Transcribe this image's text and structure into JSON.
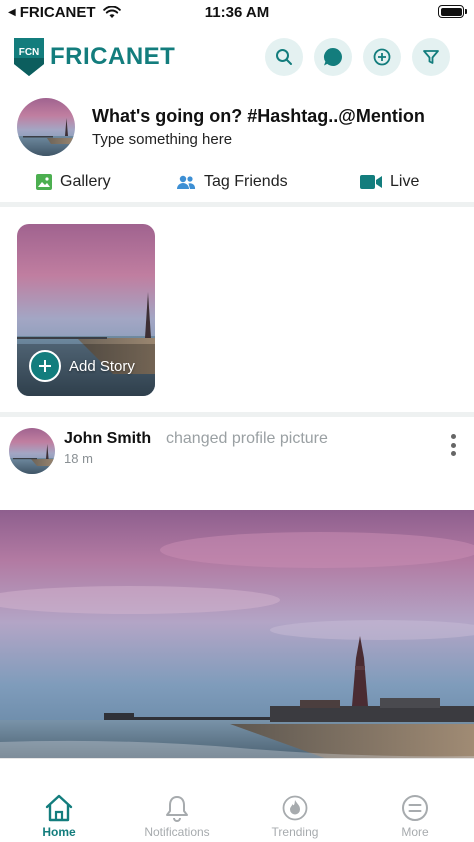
{
  "status_bar": {
    "carrier": "FRICANET",
    "time": "11:36 AM"
  },
  "header": {
    "logo_mark": "FCN",
    "logo_text": "FRICANET",
    "icons": [
      "search-icon",
      "chat-icon",
      "add-icon",
      "filter-icon"
    ]
  },
  "composer": {
    "prompt": "What's going on? #Hashtag..@Mention",
    "placeholder": "Type something here"
  },
  "actions": {
    "gallery": "Gallery",
    "tag_friends": "Tag Friends",
    "live": "Live"
  },
  "story": {
    "add_label": "Add Story"
  },
  "post": {
    "author": "John Smith",
    "action": "changed profile picture",
    "time": "18 m"
  },
  "tab_bar": {
    "active": "home",
    "tabs": [
      {
        "label": "Home",
        "icon": "home-icon"
      },
      {
        "label": "Notifications",
        "icon": "bell-icon"
      },
      {
        "label": "Trending",
        "icon": "flame-icon"
      },
      {
        "label": "More",
        "icon": "menu-icon"
      }
    ]
  },
  "colors": {
    "brand": "#137d7d",
    "icon_bg": "#e4f1f1",
    "inactive": "#a7abae"
  }
}
